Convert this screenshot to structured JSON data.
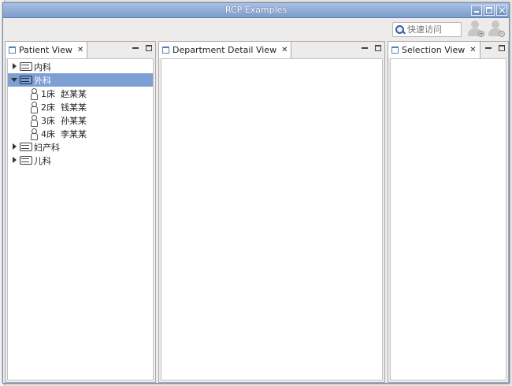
{
  "window": {
    "title": "RCP Examples"
  },
  "toolbar": {
    "quick_access_placeholder": "快速访问"
  },
  "views": {
    "patient": {
      "title": "Patient View"
    },
    "department": {
      "title": "Department Detail View"
    },
    "selection": {
      "title": "Selection View"
    }
  },
  "tree": {
    "departments": [
      {
        "label": "内科",
        "expanded": false
      },
      {
        "label": "外科",
        "expanded": true,
        "selected": true,
        "patients": [
          {
            "bed": "1床",
            "name": "赵某某"
          },
          {
            "bed": "2床",
            "name": "钱某某"
          },
          {
            "bed": "3床",
            "name": "孙某某"
          },
          {
            "bed": "4床",
            "name": "李某某"
          }
        ]
      },
      {
        "label": "妇产科",
        "expanded": false
      },
      {
        "label": "儿科",
        "expanded": false
      }
    ]
  }
}
